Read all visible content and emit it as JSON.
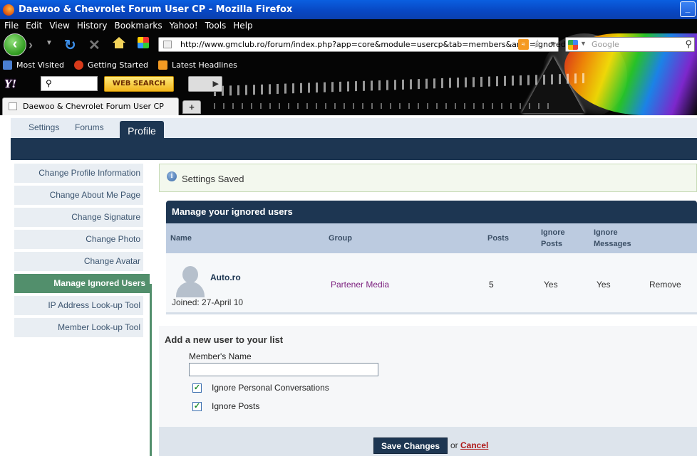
{
  "window": {
    "title": "Daewoo & Chevrolet Forum User CP - Mozilla Firefox",
    "min_glyph": "_"
  },
  "menu": [
    "File",
    "Edit",
    "View",
    "History",
    "Bookmarks",
    "Yahoo!",
    "Tools",
    "Help"
  ],
  "nav": {
    "url": "http://www.gmclub.ro/forum/index.php?app=core&module=usercp&tab=members&area=ignored",
    "search_placeholder": "Google"
  },
  "bookmarks": [
    {
      "label": "Most Visited",
      "color": "#4a7fd1"
    },
    {
      "label": "Getting Started",
      "color": "#d83a1a"
    },
    {
      "label": "Latest Headlines",
      "color": "#f29a23"
    }
  ],
  "yahoo": {
    "logo": "Y!",
    "search_value": "",
    "web_search_label": "WEB SEARCH"
  },
  "tab": {
    "title": "Daewoo & Chevrolet Forum User CP",
    "new_tab_glyph": "+"
  },
  "topnav": {
    "items": [
      "Settings",
      "Forums"
    ],
    "active": "Profile"
  },
  "sidebar": {
    "items": [
      "Change Profile Information",
      "Change About Me Page",
      "Change Signature",
      "Change Photo",
      "Change Avatar",
      "Manage Ignored Users",
      "IP Address Look-up Tool",
      "Member Look-up Tool"
    ]
  },
  "message": {
    "text": "Settings Saved"
  },
  "ignored": {
    "title": "Manage your ignored users",
    "columns": {
      "name": "Name",
      "group": "Group",
      "posts": "Posts",
      "ignore_posts": "Ignore Posts",
      "ignore_messages": "Ignore Messages"
    },
    "rows": [
      {
        "name": "Auto.ro",
        "joined": "Joined: 27-April 10",
        "group": "Partener Media",
        "posts": "5",
        "ignore_posts": "Yes",
        "ignore_messages": "Yes",
        "action": "Remove"
      }
    ]
  },
  "add": {
    "title": "Add a new user to your list",
    "member_label": "Member's Name",
    "member_value": "",
    "check1": "Ignore Personal Conversations",
    "check2": "Ignore Posts"
  },
  "footer": {
    "save": "Save Changes",
    "or": "or",
    "cancel": "Cancel"
  },
  "colors": {
    "navy": "#1d3652",
    "green": "#528f6c",
    "group_purple": "#7c1f7e",
    "cancel_red": "#b01b1b"
  }
}
